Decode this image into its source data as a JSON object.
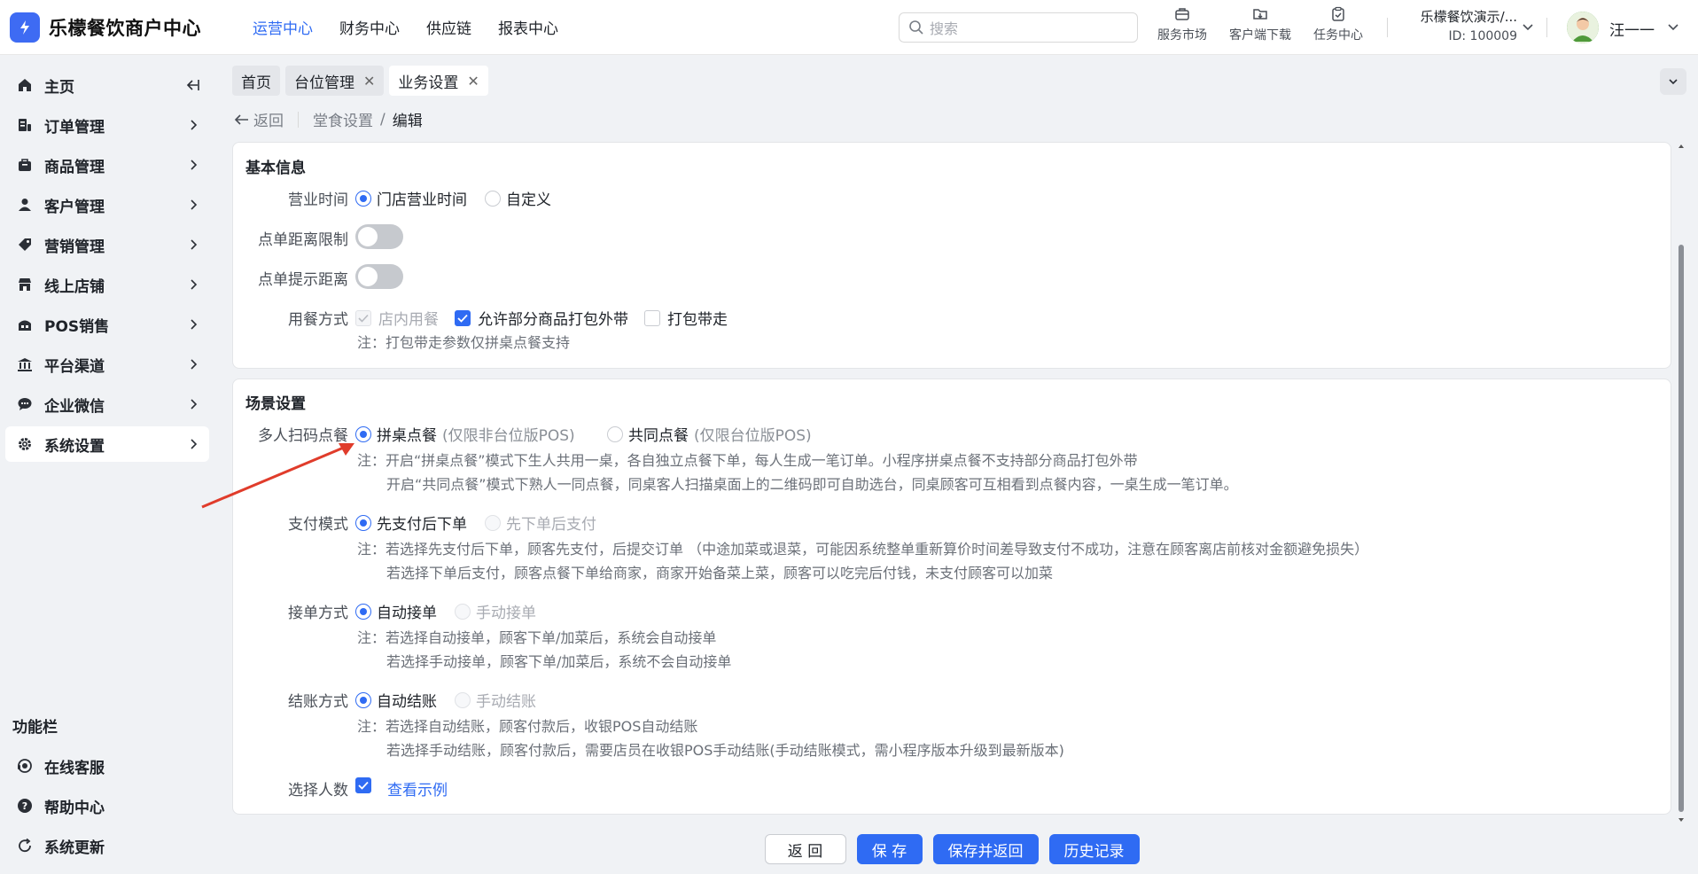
{
  "header": {
    "brand": "乐檬餐饮商户中心",
    "nav": [
      "运营中心",
      "财务中心",
      "供应链",
      "报表中心"
    ],
    "nav_active": 0,
    "search_placeholder": "搜索",
    "tools": [
      {
        "icon": "briefcase-icon",
        "label": "服务市场"
      },
      {
        "icon": "download-icon",
        "label": "客户端下载"
      },
      {
        "icon": "clipboard-check-icon",
        "label": "任务中心"
      }
    ],
    "org_name": "乐檬餐饮演示/...",
    "org_id": "ID: 100009",
    "username": "汪一一"
  },
  "sidebar": {
    "items": [
      {
        "label": "主页",
        "icon": "home-icon"
      },
      {
        "label": "订单管理",
        "icon": "order-icon"
      },
      {
        "label": "商品管理",
        "icon": "product-icon"
      },
      {
        "label": "客户管理",
        "icon": "customer-icon"
      },
      {
        "label": "营销管理",
        "icon": "tag-icon"
      },
      {
        "label": "线上店铺",
        "icon": "store-icon"
      },
      {
        "label": "POS销售",
        "icon": "pos-icon"
      },
      {
        "label": "平台渠道",
        "icon": "bank-icon"
      },
      {
        "label": "企业微信",
        "icon": "wechat-icon"
      },
      {
        "label": "系统设置",
        "icon": "gear-icon"
      }
    ],
    "active": 9,
    "func_title": "功能栏",
    "func_items": [
      {
        "label": "在线客服",
        "icon": "headset-icon"
      },
      {
        "label": "帮助中心",
        "icon": "help-icon"
      },
      {
        "label": "系统更新",
        "icon": "refresh-icon"
      }
    ]
  },
  "tabs": [
    {
      "label": "首页",
      "closable": false
    },
    {
      "label": "台位管理",
      "closable": true
    },
    {
      "label": "业务设置",
      "closable": true,
      "active": true
    }
  ],
  "breadcrumb": {
    "back": "返回",
    "parent": "堂食设置",
    "sep": "/",
    "current": "编辑"
  },
  "basic": {
    "title": "基本信息",
    "hours_label": "营业时间",
    "hours_opt1": "门店营业时间",
    "hours_opt2": "自定义",
    "distance_limit_label": "点单距离限制",
    "distance_tip_label": "点单提示距离",
    "dining_label": "用餐方式",
    "dining_opt1": "店内用餐",
    "dining_opt2": "允许部分商品打包外带",
    "dining_opt3": "打包带走",
    "dining_note": "注：打包带走参数仅拼桌点餐支持"
  },
  "scene": {
    "title": "场景设置",
    "multi_label": "多人扫码点餐",
    "multi_opt1": "拼桌点餐",
    "multi_opt1_hint": "(仅限非台位版POS)",
    "multi_opt2": "共同点餐",
    "multi_opt2_hint": "(仅限台位版POS)",
    "multi_note1": "注：开启“拼桌点餐”模式下生人共用一桌，各自独立点餐下单，每人生成一笔订单。小程序拼桌点餐不支持部分商品打包外带",
    "multi_note2": "开启“共同点餐”模式下熟人一同点餐，同桌客人扫描桌面上的二维码即可自助选台，同桌顾客可互相看到点餐内容，一桌生成一笔订单。",
    "pay_label": "支付模式",
    "pay_opt1": "先支付后下单",
    "pay_opt2": "先下单后支付",
    "pay_note1": "注：若选择先支付后下单，顾客先支付，后提交订单 （中途加菜或退菜，可能因系统整单重新算价时间差导致支付不成功，注意在顾客离店前核对金额避免损失）",
    "pay_note2": "若选择下单后支付，顾客点餐下单给商家，商家开始备菜上菜，顾客可以吃完后付钱，未支付顾客可以加菜",
    "accept_label": "接单方式",
    "accept_opt1": "自动接单",
    "accept_opt2": "手动接单",
    "accept_note1": "注：若选择自动接单，顾客下单/加菜后，系统会自动接单",
    "accept_note2": "若选择手动接单，顾客下单/加菜后，系统不会自动接单",
    "checkout_label": "结账方式",
    "checkout_opt1": "自动结账",
    "checkout_opt2": "手动结账",
    "checkout_note1": "注：若选择自动结账，顾客付款后，收银POS自动结账",
    "checkout_note2": "若选择手动结账，顾客付款后，需要店员在收银POS手动结账(手动结账模式，需小程序版本升级到最新版本)",
    "people_label": "选择人数",
    "people_link": "查看示例"
  },
  "footer": {
    "back": "返 回",
    "save": "保 存",
    "save_back": "保存并返回",
    "history": "历史记录"
  },
  "colors": {
    "primary": "#2f6bf3",
    "annotation_arrow": "#e03c2b"
  }
}
